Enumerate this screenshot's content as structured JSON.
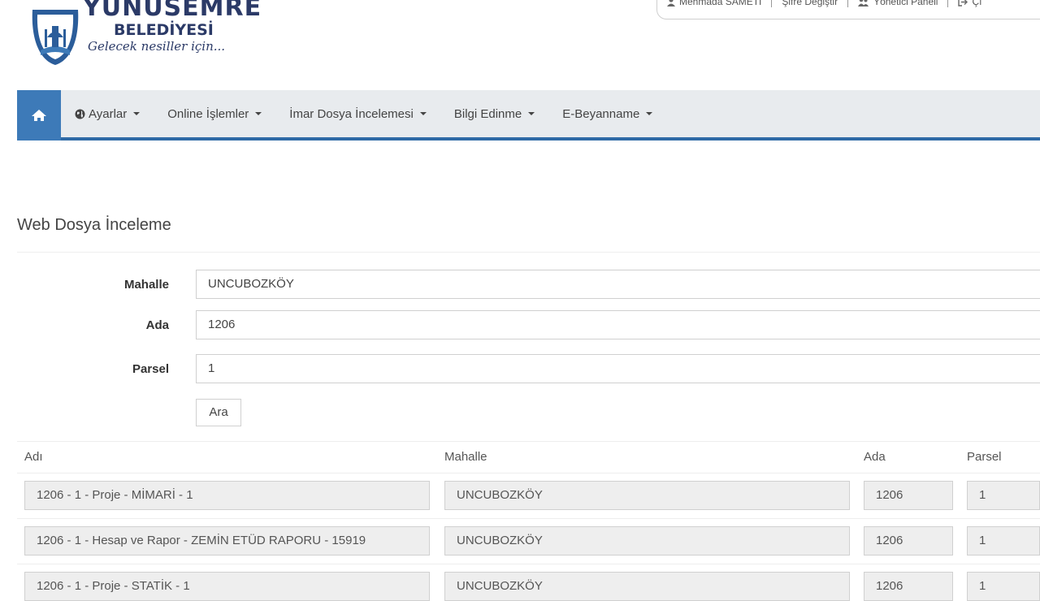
{
  "logo": {
    "line1": "YUNUSEMRE",
    "line2": "BELEDİYESİ",
    "tagline": "Gelecek nesiller için..."
  },
  "topbar": {
    "user": "Mehmada SAMETİ",
    "password": "Şifre Değiştir",
    "admin": "Yönetici Paneli",
    "exit": "Çı"
  },
  "nav": {
    "items": [
      {
        "label": "Ayarlar"
      },
      {
        "label": "Online İşlemler"
      },
      {
        "label": "İmar Dosya İncelemesi"
      },
      {
        "label": "Bilgi Edinme"
      },
      {
        "label": "E-Beyanname"
      }
    ]
  },
  "page": {
    "title": "Web Dosya İnceleme"
  },
  "form": {
    "mahalle_label": "Mahalle",
    "mahalle_value": "UNCUBOZKÖY",
    "ada_label": "Ada",
    "ada_value": "1206",
    "parsel_label": "Parsel",
    "parsel_value": "1",
    "search_button": "Ara"
  },
  "table": {
    "headers": [
      "Adı",
      "Mahalle",
      "Ada",
      "Parsel"
    ],
    "rows": [
      [
        "1206 - 1 - Proje - MİMARİ - 1",
        "UNCUBOZKÖY",
        "1206",
        "1"
      ],
      [
        "1206 - 1 - Hesap ve Rapor - ZEMİN ETÜD RAPORU - 15919",
        "UNCUBOZKÖY",
        "1206",
        "1"
      ],
      [
        "1206 - 1 - Proje - STATİK - 1",
        "UNCUBOZKÖY",
        "1206",
        "1"
      ]
    ]
  },
  "colors": {
    "accent": "#3d7ab8",
    "navbar_bg": "#e8ebee",
    "brand_text": "#2b3a67"
  }
}
